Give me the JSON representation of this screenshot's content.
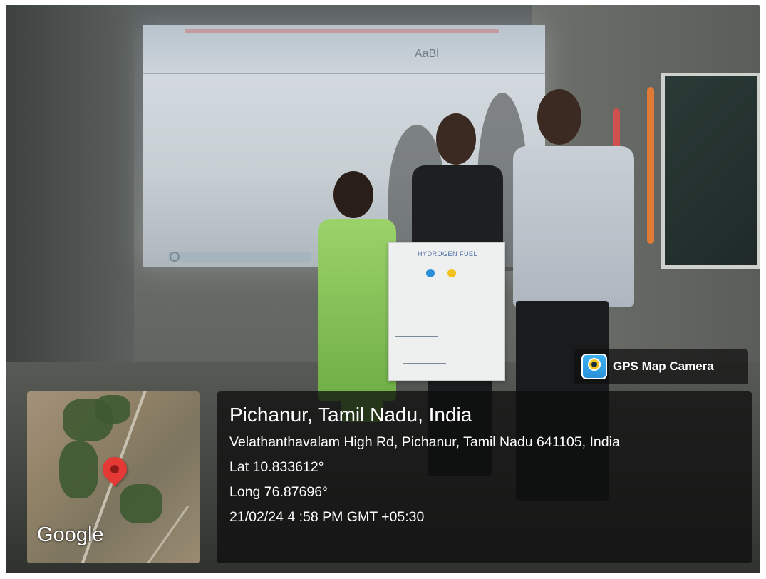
{
  "overlay": {
    "brand_label": "GPS Map Camera",
    "brand_icon": "gps-map-camera-logo-icon",
    "place_title": "Pichanur, Tamil Nadu, India",
    "address": "Velathanthavalam High Rd, Pichanur, Tamil Nadu 641105, India",
    "latitude": "Lat 10.833612°",
    "longitude": "Long 76.87696°",
    "datetime": "21/02/24 4 :58 PM GMT +05:30"
  },
  "map": {
    "attribution": "Google",
    "pin_icon": "map-pin-icon",
    "pin_color": "#e53935"
  },
  "scene": {
    "projection_text": "AaBl",
    "poster_title": "HYDROGEN FUEL"
  }
}
